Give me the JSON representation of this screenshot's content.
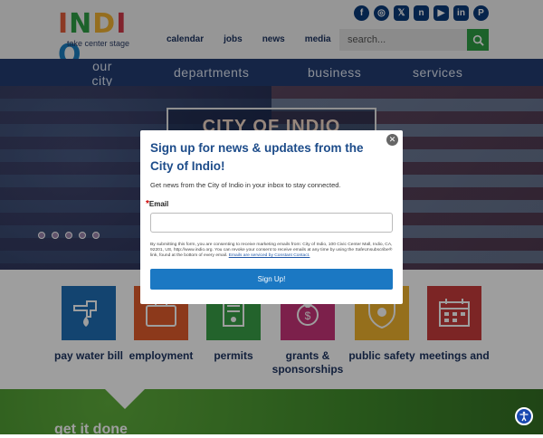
{
  "header": {
    "logo_text": "INDIO",
    "logo_letters": [
      {
        "ch": "I",
        "color": "#e25c3b"
      },
      {
        "ch": "N",
        "color": "#2e9e44"
      },
      {
        "ch": "D",
        "color": "#f1b233"
      },
      {
        "ch": "I",
        "color": "#d1394a"
      },
      {
        "ch": "O",
        "color": "#1a7fc1"
      }
    ],
    "tagline": "take center stage",
    "social": [
      "facebook-icon",
      "instagram-icon",
      "x-icon",
      "nextdoor-icon",
      "youtube-icon",
      "linkedin-icon",
      "pinterest-icon"
    ],
    "social_glyphs": [
      "f",
      "◎",
      "𝕏",
      "n",
      "▶",
      "in",
      "P"
    ],
    "topnav": [
      "calendar",
      "jobs",
      "news",
      "media"
    ],
    "search_placeholder": "search...",
    "accent": "#2e9e44"
  },
  "mainnav": {
    "items": [
      "our\ncity",
      "departments",
      "business",
      "services"
    ],
    "bg": "#233d72"
  },
  "hero": {
    "sign_title": "CITY OF INDIO",
    "slides": 5
  },
  "tiles": [
    {
      "label": "pay water bill",
      "color": "#1f6fb5",
      "icon": "water-faucet-icon"
    },
    {
      "label": "employment",
      "color": "#e35c2c",
      "icon": "briefcase-icon"
    },
    {
      "label": "permits",
      "color": "#39a047",
      "icon": "permit-document-icon"
    },
    {
      "label": "grants & sponsorships",
      "color": "#c8357a",
      "icon": "money-bag-icon"
    },
    {
      "label": "public safety",
      "color": "#f0b32e",
      "icon": "badge-icon"
    },
    {
      "label": "meetings and",
      "color": "#c83c3c",
      "icon": "calendar-icon"
    }
  ],
  "band": {
    "title": "get it done"
  },
  "modal": {
    "title": "Sign up for news & updates from the City of Indio!",
    "description": "Get news from the City of Indio in your inbox to stay connected.",
    "email_label": "Email",
    "required_mark": "*",
    "consent": "By submitting this form, you are consenting to receive marketing emails from: City of Indio, 100 Civic Center Mall, Indio, CA, 92201, US, http://www.indio.org. You can revoke your consent to receive emails at any time by using the SafeUnsubscribe® link, found at the bottom of every email. ",
    "consent_link": "Emails are serviced by Constant Contact.",
    "button": "Sign Up!",
    "close": "✕"
  }
}
